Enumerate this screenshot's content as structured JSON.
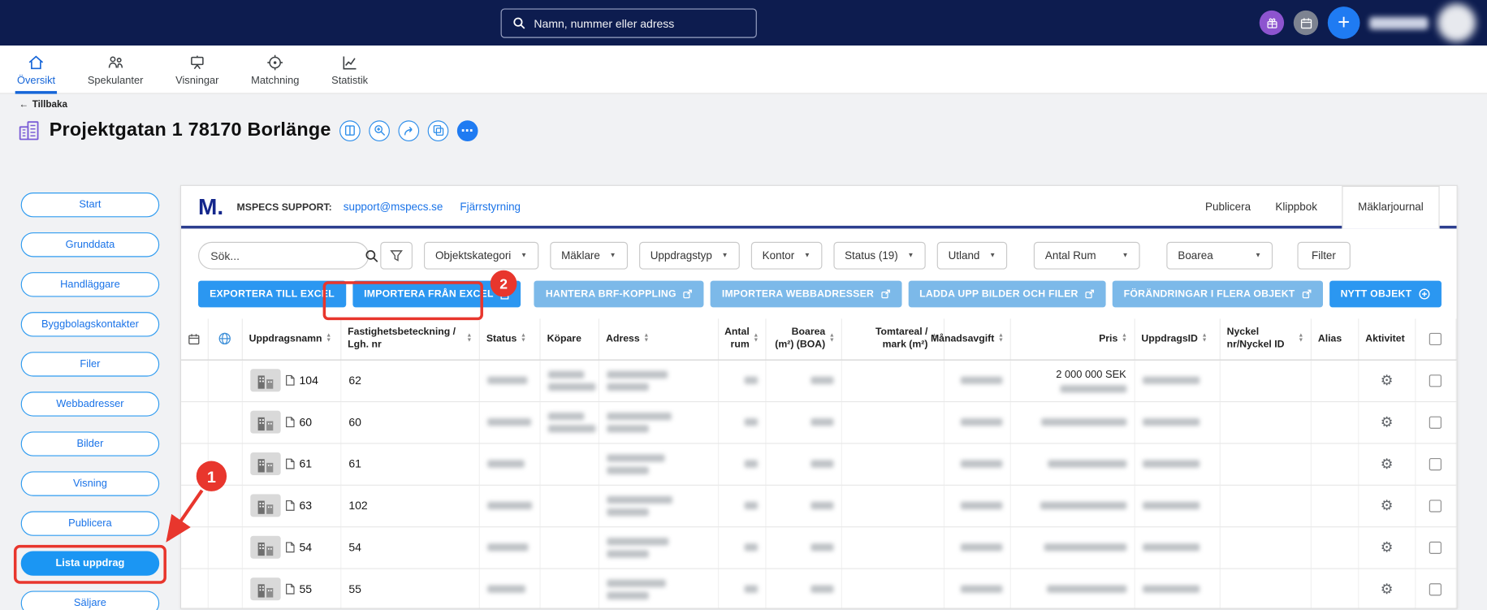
{
  "topbar": {
    "search_placeholder": "Namn, nummer eller adress"
  },
  "tabs": [
    {
      "label": "Översikt"
    },
    {
      "label": "Spekulanter"
    },
    {
      "label": "Visningar"
    },
    {
      "label": "Matchning"
    },
    {
      "label": "Statistik"
    }
  ],
  "breadcrumb": {
    "back_label": "Tillbaka"
  },
  "page": {
    "title": "Projektgatan 1 78170 Borlänge"
  },
  "sidebar": {
    "items": [
      {
        "label": "Start"
      },
      {
        "label": "Grunddata"
      },
      {
        "label": "Handläggare"
      },
      {
        "label": "Byggbolagskontakter"
      },
      {
        "label": "Filer"
      },
      {
        "label": "Webbadresser"
      },
      {
        "label": "Bilder"
      },
      {
        "label": "Visning"
      },
      {
        "label": "Publicera"
      },
      {
        "label": "Lista uppdrag"
      },
      {
        "label": "Säljare"
      }
    ]
  },
  "support": {
    "logo": "M.",
    "label": "MSPECS SUPPORT:",
    "email": "support@mspecs.se",
    "remote_link": "Fjärrstyrning",
    "tabs": [
      {
        "label": "Publicera"
      },
      {
        "label": "Klippbok"
      },
      {
        "label": "Mäklarjournal"
      }
    ]
  },
  "filters": {
    "search_placeholder": "Sök...",
    "dropdowns": [
      "Objektskategori",
      "Mäklare",
      "Uppdragstyp",
      "Kontor",
      "Status (19)",
      "Utland",
      "Antal Rum",
      "Boarea"
    ],
    "filter_label": "Filter"
  },
  "actions": {
    "export_excel": "EXPORTERA TILL EXCEL",
    "import_excel": "IMPORTERA FRÅN EXCEL",
    "brf": "HANTERA BRF-KOPPLING",
    "import_web": "IMPORTERA WEBBADRESSER",
    "upload": "LADDA UPP BILDER OCH FILER",
    "bulk_change": "FÖRÄNDRINGAR I FLERA OBJEKT",
    "new_object": "NYTT OBJEKT"
  },
  "table": {
    "columns": [
      {
        "key": "calendar",
        "type": "icon",
        "icon": "calendar-icon"
      },
      {
        "key": "globe",
        "type": "icon",
        "icon": "globe-icon"
      },
      {
        "key": "uppdragsnamn",
        "label": "Uppdragsnamn",
        "sortable": true
      },
      {
        "key": "fastighetsbeteckning",
        "label": "Fastighetsbeteckning / Lgh. nr",
        "sortable": true
      },
      {
        "key": "status",
        "label": "Status",
        "sortable": true
      },
      {
        "key": "kopare",
        "label": "Köpare",
        "sortable": false
      },
      {
        "key": "adress",
        "label": "Adress",
        "sortable": true
      },
      {
        "key": "antal-rum",
        "label": "Antal rum",
        "sortable": true,
        "align": "right"
      },
      {
        "key": "boarea",
        "label": "Boarea (m²) (BOA)",
        "sortable": true,
        "align": "right"
      },
      {
        "key": "tomtareal",
        "label": "Tomtareal / mark (m²)",
        "sortable": true,
        "align": "right"
      },
      {
        "key": "manadsavgift",
        "label": "Månadsavgift",
        "sortable": true,
        "align": "right"
      },
      {
        "key": "pris",
        "label": "Pris",
        "sortable": true,
        "align": "right"
      },
      {
        "key": "uppdragsid",
        "label": "UppdragsID",
        "sortable": true
      },
      {
        "key": "nyckel",
        "label": "Nyckel nr/Nyckel ID",
        "sortable": true
      },
      {
        "key": "alias",
        "label": "Alias",
        "sortable": false
      },
      {
        "key": "aktivitet",
        "label": "Aktivitet",
        "sortable": false
      },
      {
        "key": "select",
        "type": "checkbox"
      }
    ],
    "rows": [
      {
        "thumb_badge": "104",
        "lgh_nr": "62",
        "pris_text": "2 000 000 SEK",
        "has_kopare": true
      },
      {
        "thumb_badge": "60",
        "lgh_nr": "60",
        "has_kopare": true
      },
      {
        "thumb_badge": "61",
        "lgh_nr": "61"
      },
      {
        "thumb_badge": "63",
        "lgh_nr": "102"
      },
      {
        "thumb_badge": "54",
        "lgh_nr": "54"
      },
      {
        "thumb_badge": "55",
        "lgh_nr": "55"
      }
    ]
  },
  "annotations": {
    "step1": "1",
    "step2": "2",
    "color": "#e8362d"
  }
}
